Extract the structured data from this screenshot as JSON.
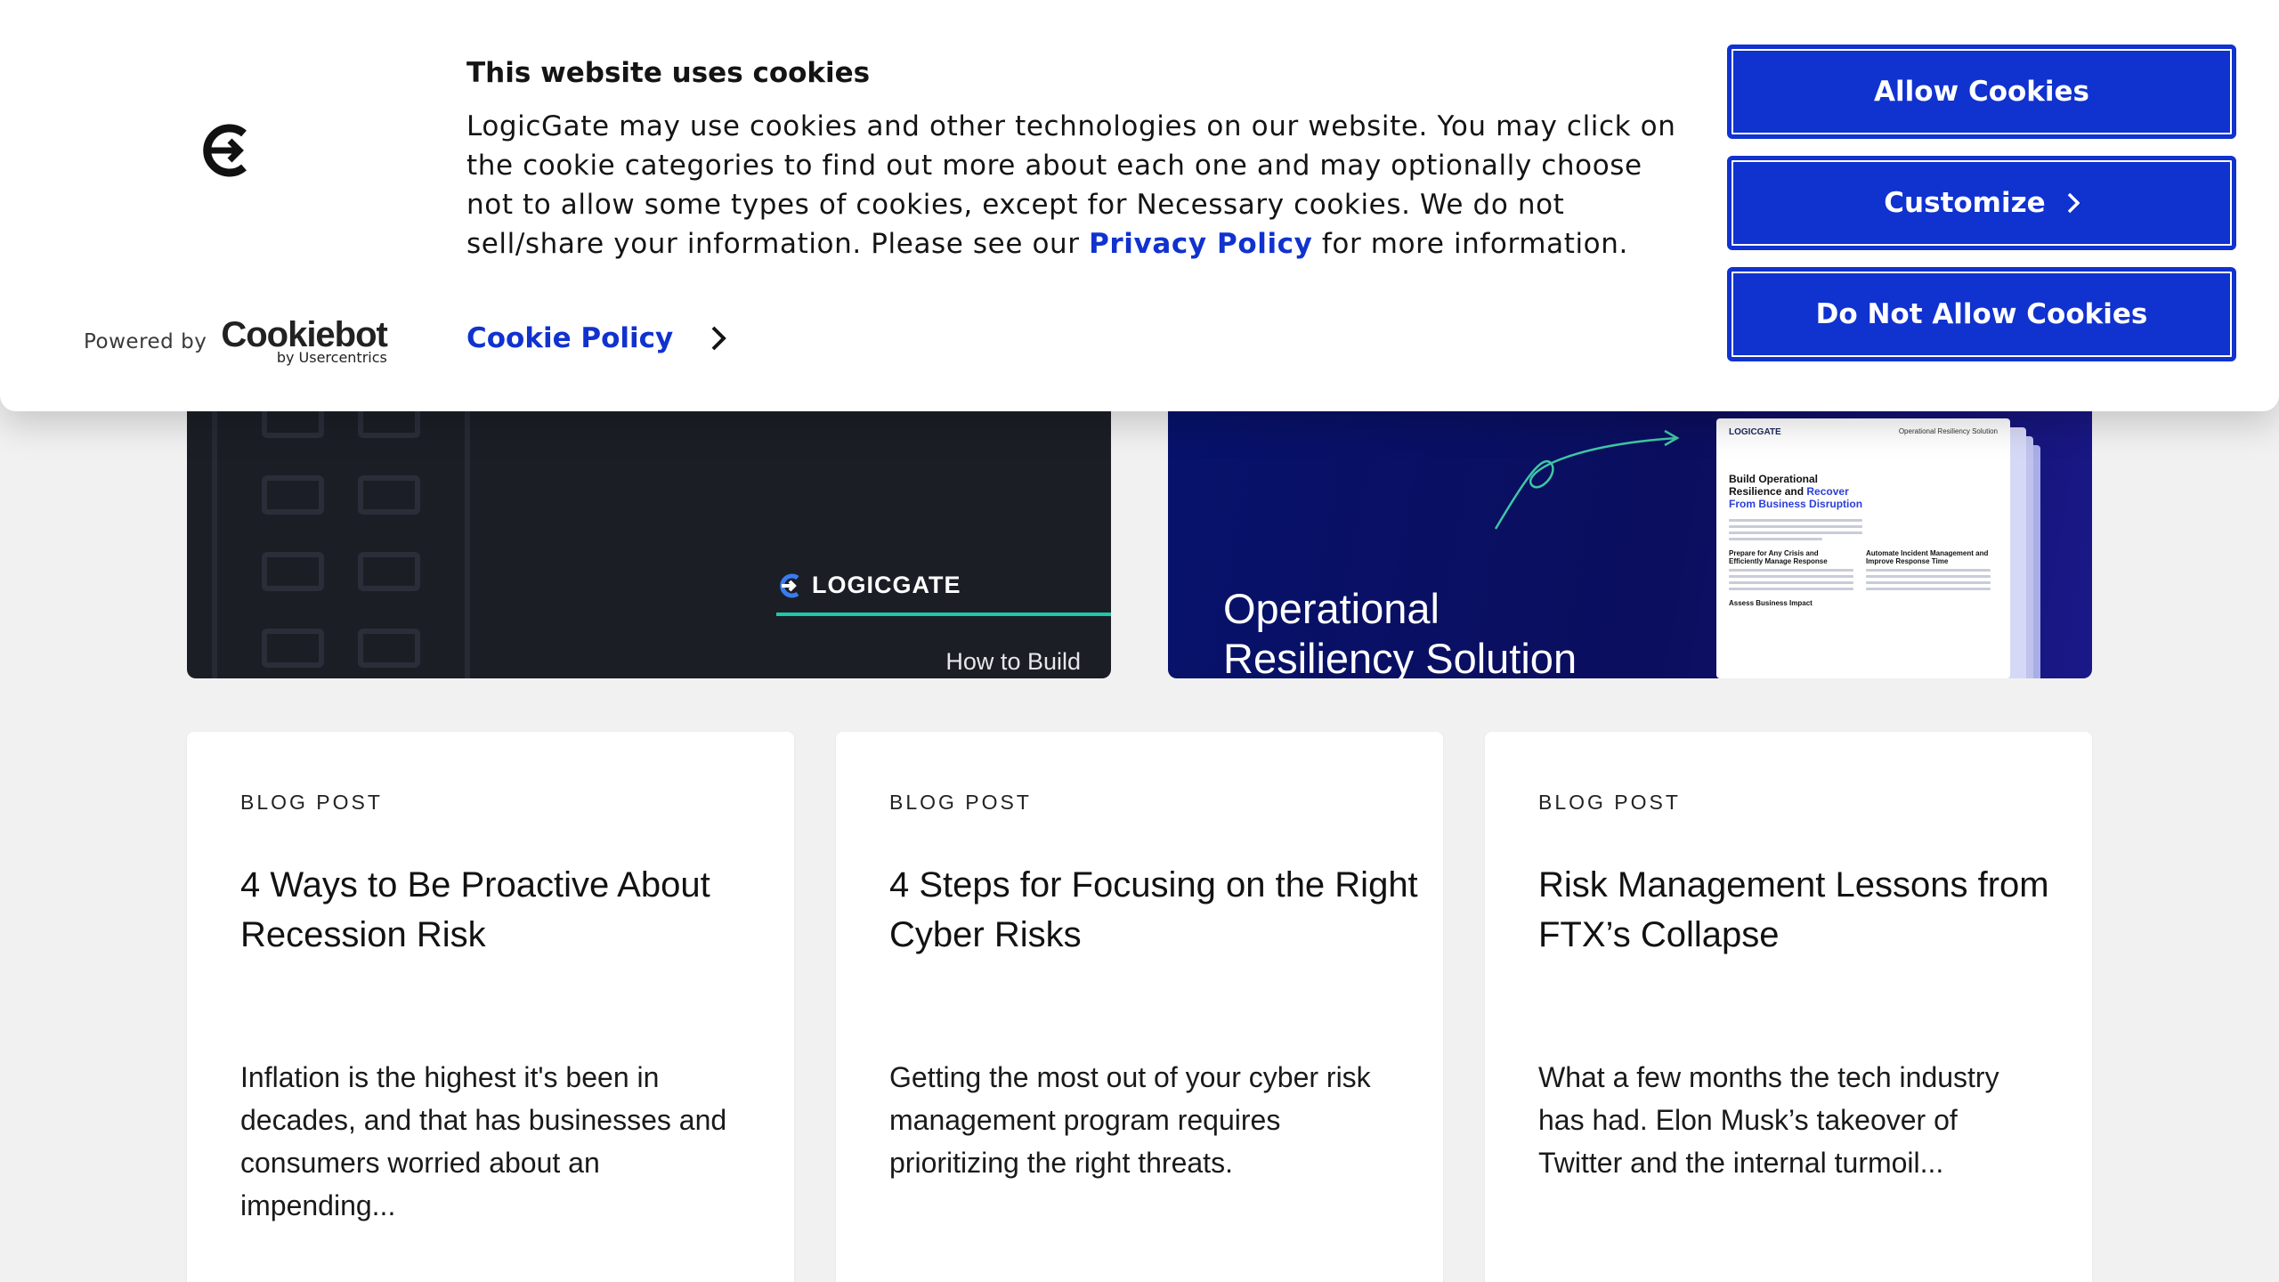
{
  "cookie_banner": {
    "heading": "This website uses cookies",
    "body_before_link": "LogicGate may use cookies and other technologies on our website. You may click on the cookie categories to find out more about each one and may optionally choose not to allow some types of cookies, except for Necessary cookies.  We do not sell/share your information. Please see our ",
    "privacy_link": "Privacy Policy",
    "body_after_link": " for more information.",
    "cookie_policy_link": "Cookie Policy",
    "powered_by": "Powered by",
    "cookiebot_brand": "Cookiebot",
    "by_usercentrics": "by Usercentrics",
    "buttons": {
      "allow": "Allow Cookies",
      "customize": "Customize",
      "deny": "Do Not Allow Cookies"
    },
    "accent_color": "#1032cf"
  },
  "features": [
    {
      "brand": "LOGICGATE",
      "caption": "How to Build"
    },
    {
      "headline_line1": "Operational",
      "headline_line2": "Resiliency Solution",
      "doc": {
        "logo": "LOGICGATE",
        "header": "Operational Resiliency Solution",
        "title_part1": "Build Operational Resilience and ",
        "title_highlight": "Recover From Business Disruption",
        "sub1": "Prepare for Any Crisis and Efficiently Manage Response",
        "sub2": "Automate Incident Management and Improve Response Time",
        "sub3": "Assess Business Impact"
      }
    }
  ],
  "blog_cards": [
    {
      "kind": "BLOG POST",
      "title": "4 Ways to Be Proactive About Recession Risk",
      "excerpt": "Inflation is the highest it's been in decades, and that has businesses and consumers worried about an impending..."
    },
    {
      "kind": "BLOG POST",
      "title": "4 Steps for Focusing on the Right Cyber Risks",
      "excerpt": "Getting the most out of your cyber risk management program requires prioritizing the right threats."
    },
    {
      "kind": "BLOG POST",
      "title": "Risk Management Lessons from FTX’s Collapse",
      "excerpt": "What a few months the tech industry has had.  Elon Musk’s takeover of Twitter and the internal turmoil..."
    }
  ]
}
